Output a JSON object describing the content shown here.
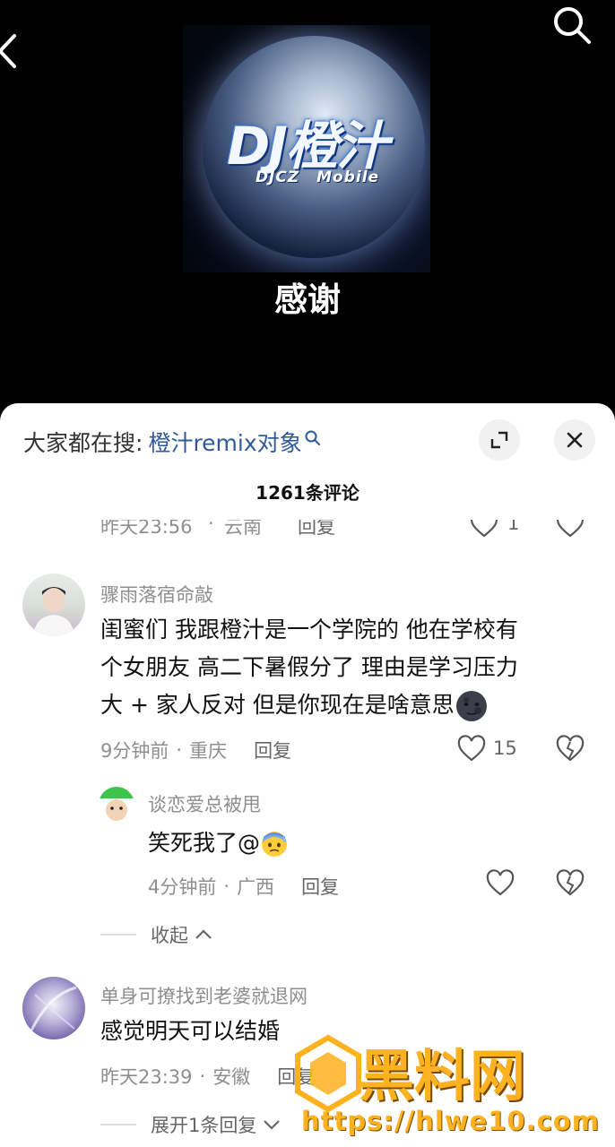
{
  "cover": {
    "title": "DJ橙汁",
    "subtitle": "DJCZ Mobile"
  },
  "song": {
    "title": "感谢"
  },
  "sheet": {
    "search_label": "大家都在搜:",
    "search_term": "橙汁remix对象",
    "comment_count": "1261条评论"
  },
  "partial_row": {
    "time": "昨天23:56",
    "location": "云南",
    "reply": "回复",
    "likes": "1"
  },
  "comments": [
    {
      "username": "骤雨落宿命敲",
      "lines": [
        "闺蜜们 我跟橙汁是一个学院的 他在学校有",
        "个女朋友 高二下暑假分了 理由是学习压力",
        "大 + 家人反对 但是你现在是啥意思"
      ],
      "emoji": "new-moon-face",
      "time": "9分钟前",
      "location": "重庆",
      "reply": "回复",
      "likes": "15"
    },
    {
      "username": "谈恋爱总被甩",
      "text": "笑死我了@",
      "emoji": "anxious-sweat-face",
      "time": "4分钟前",
      "location": "广西",
      "reply": "回复",
      "likes": ""
    },
    {
      "username": "单身可撩找到老婆就退网",
      "text": "感觉明天可以结婚",
      "time": "昨天23:39",
      "location": "安徽",
      "reply": "回复"
    }
  ],
  "collapse_label": "收起",
  "expand_label": "展开1条回复",
  "watermark": {
    "brand": "黑料网",
    "url": "https://hlwe10.com"
  },
  "colors": {
    "accent_link": "#2f5a99",
    "watermark": "#ffb21f"
  }
}
